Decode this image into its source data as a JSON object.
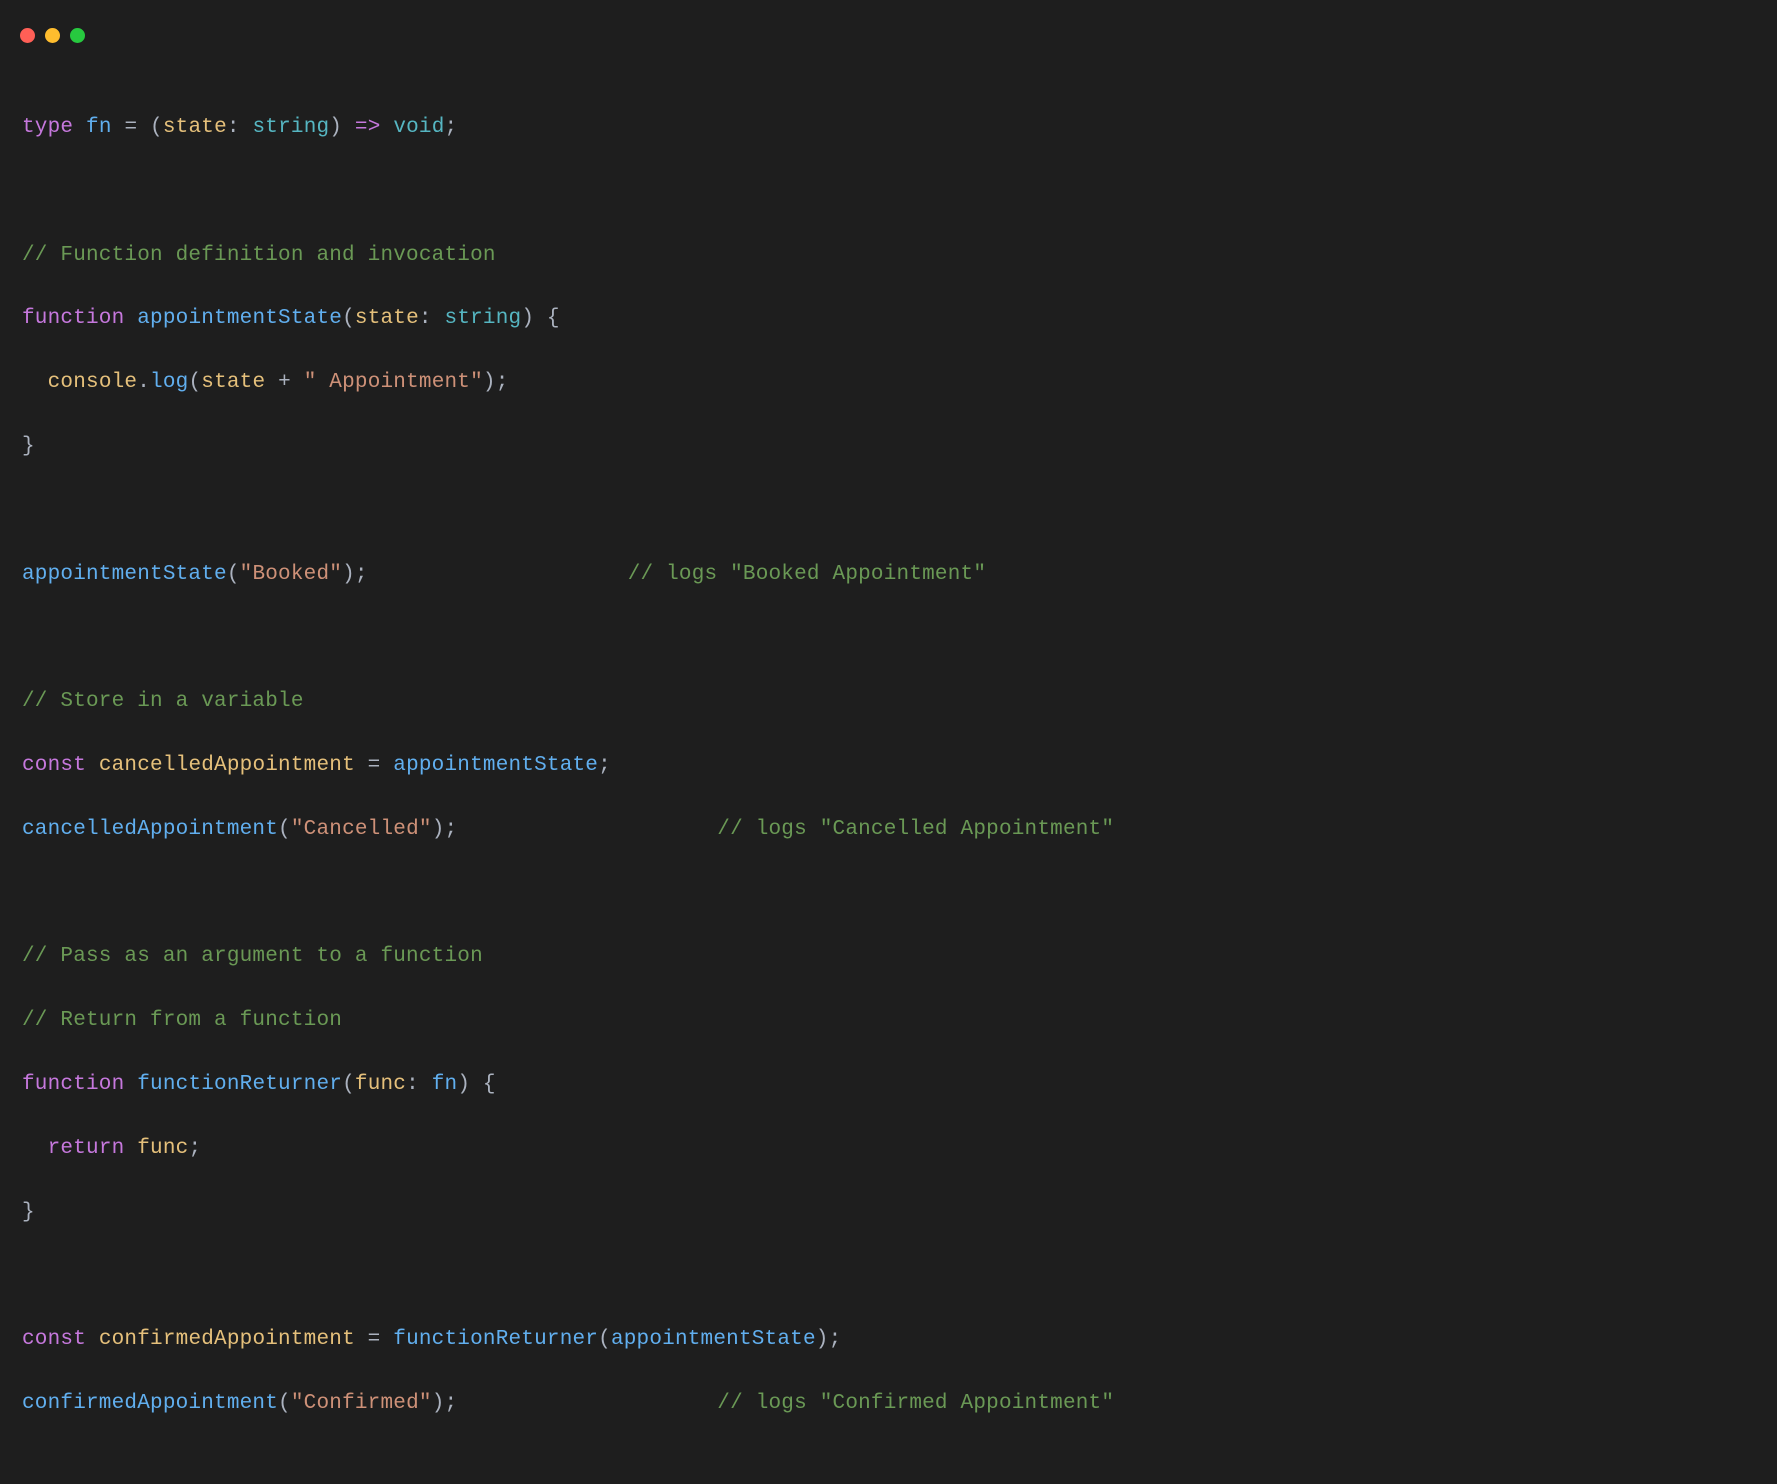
{
  "code": {
    "l1": {
      "kw_type": "type",
      "name_fn": "fn",
      "eq": " = ",
      "lparen": "(",
      "param_state": "state",
      "colon": ": ",
      "t_string": "string",
      "rparen": ")",
      "arrow": " => ",
      "t_void": "void",
      "semi": ";"
    },
    "l3_comment": "// Function definition and invocation",
    "l4": {
      "kw_function": "function",
      "name": "appointmentState",
      "lparen": "(",
      "param": "state",
      "colon": ": ",
      "t_string": "string",
      "rparen_brace": ") {"
    },
    "l5": {
      "indent": "  ",
      "console": "console",
      "dot": ".",
      "log": "log",
      "lparen": "(",
      "state": "state",
      "plus": " + ",
      "str": "\" Appointment\"",
      "rparen_semi": ");"
    },
    "l6_close": "}",
    "l8": {
      "call": "appointmentState",
      "lparen": "(",
      "arg": "\"Booked\"",
      "rparen_semi": ");",
      "comment": "// logs \"Booked Appointment\""
    },
    "l10_comment": "// Store in a variable",
    "l11": {
      "kw_const": "const",
      "name": "cancelledAppointment",
      "eq": " = ",
      "rhs": "appointmentState",
      "semi": ";"
    },
    "l12": {
      "call": "cancelledAppointment",
      "lparen": "(",
      "arg": "\"Cancelled\"",
      "rparen_semi": ");",
      "comment": "// logs \"Cancelled Appointment\""
    },
    "l14_comment": "// Pass as an argument to a function",
    "l15_comment": "// Return from a function",
    "l16": {
      "kw_function": "function",
      "name": "functionReturner",
      "lparen": "(",
      "param": "func",
      "colon": ": ",
      "t_fn": "fn",
      "rparen_brace": ") {"
    },
    "l17": {
      "indent": "  ",
      "kw_return": "return",
      "sp": " ",
      "ident": "func",
      "semi": ";"
    },
    "l18_close": "}",
    "l20": {
      "kw_const": "const",
      "name": "confirmedAppointment",
      "eq": " = ",
      "fnret": "functionReturner",
      "lparen": "(",
      "arg_ident": "appointmentState",
      "rparen_semi": ");"
    },
    "l21": {
      "call": "confirmedAppointment",
      "lparen": "(",
      "arg": "\"Confirmed\"",
      "rparen_semi": ");",
      "comment": "// logs \"Confirmed Appointment\""
    }
  }
}
